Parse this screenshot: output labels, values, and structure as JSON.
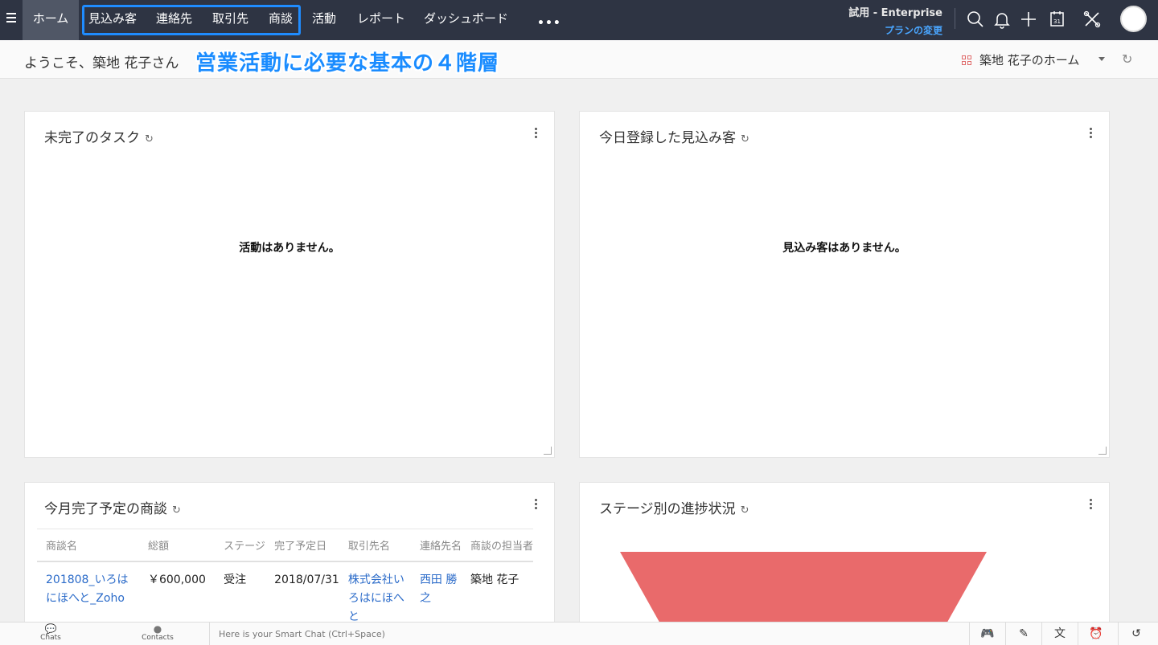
{
  "nav": {
    "home": "ホーム",
    "items": [
      "見込み客",
      "連絡先",
      "取引先",
      "商談",
      "活動",
      "レポート",
      "ダッシュボード"
    ],
    "more": "•••"
  },
  "trial": {
    "title": "試用 - Enterprise",
    "link": "プランの変更"
  },
  "welcome": {
    "text": "ようこそ、築地 花子さん",
    "callout": "営業活動に必要な基本の４階層",
    "home_select": "築地 花子のホーム"
  },
  "cards": {
    "tasks": {
      "title": "未完了のタスク",
      "empty": "活動はありません。"
    },
    "leads": {
      "title": "今日登録した見込み客",
      "empty": "見込み客はありません。"
    },
    "deals": {
      "title": "今月完了予定の商談"
    },
    "stage": {
      "title": "ステージ別の進捗状況"
    }
  },
  "deals_table": {
    "headers": [
      "商談名",
      "総額",
      "ステージ",
      "完了予定日",
      "取引先名",
      "連絡先名",
      "商談の担当者"
    ],
    "rows": [
      [
        "201808_いろはにほへと_Zoho",
        "￥600,000",
        "受注",
        "2018/07/31",
        "株式会社いろはにほへと",
        "西田 勝之",
        "築地 花子"
      ]
    ]
  },
  "bottom": {
    "chats": "Chats",
    "contacts": "Contacts",
    "chat_placeholder": "Here is your Smart Chat (Ctrl+Space)"
  },
  "colors": {
    "topbar": "#2e3443",
    "highlight": "#1f8cff",
    "funnel": "#e96a6b",
    "link": "#2b6bc9"
  }
}
